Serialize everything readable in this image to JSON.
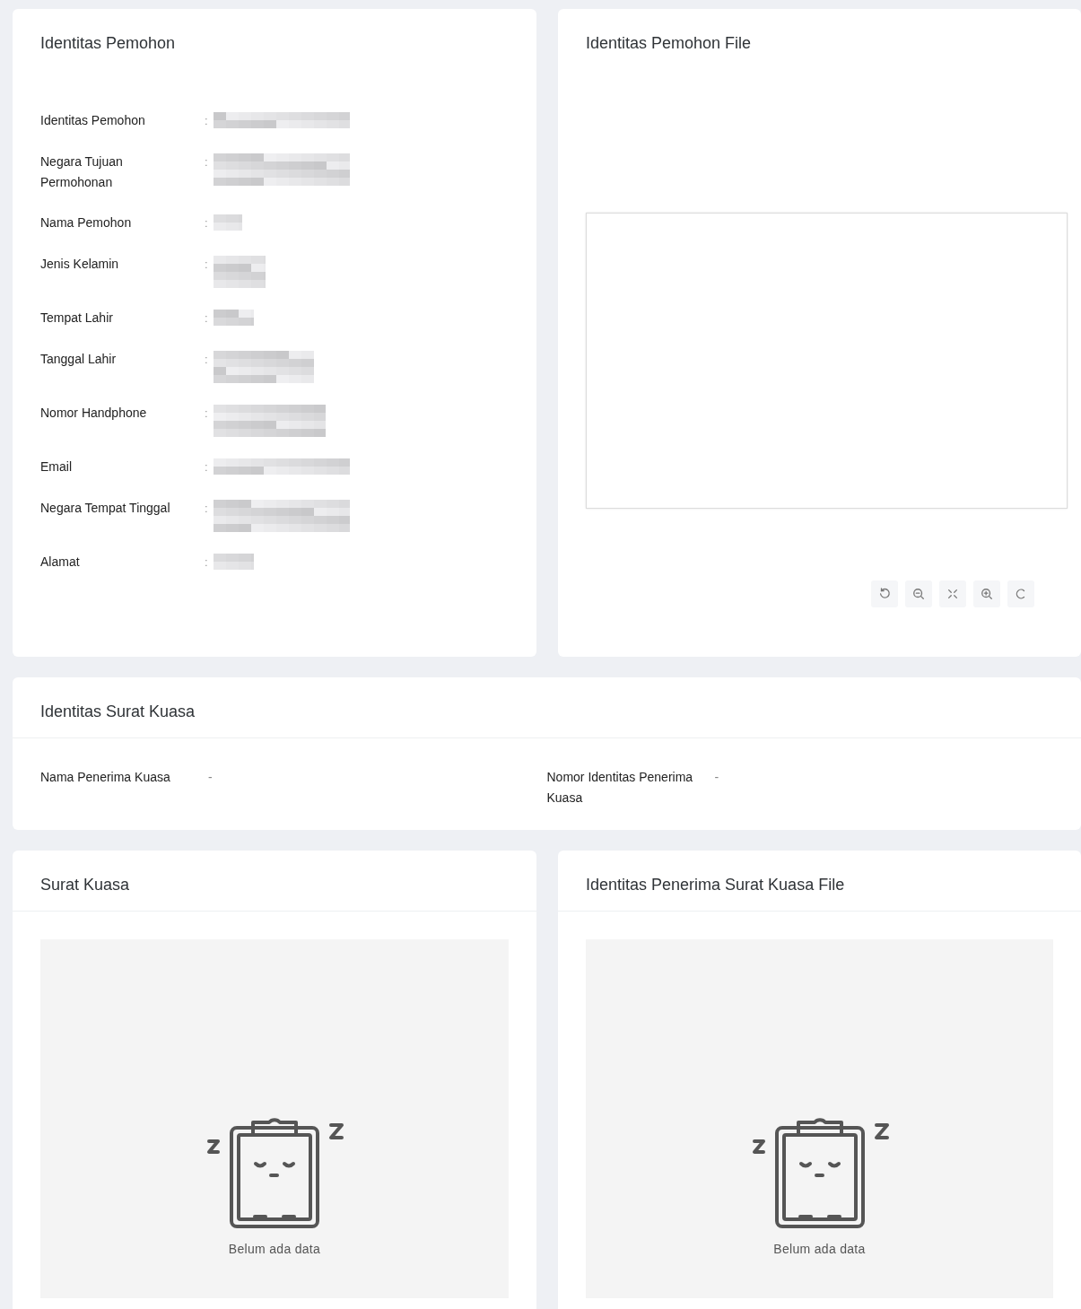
{
  "applicant": {
    "title": "Identitas Pemohon",
    "fields": [
      {
        "label": "Identitas Pemohon",
        "separator": ":",
        "redacted": true
      },
      {
        "label": "Negara Tujuan Permohonan",
        "separator": ":",
        "redacted": true
      },
      {
        "label": "Nama Pemohon",
        "separator": ":",
        "redacted": true
      },
      {
        "label": "Jenis Kelamin",
        "separator": ":",
        "redacted": true
      },
      {
        "label": "Tempat Lahir",
        "separator": ":",
        "redacted": true
      },
      {
        "label": "Tanggal Lahir",
        "separator": ":",
        "redacted": true
      },
      {
        "label": "Nomor Handphone",
        "separator": ":",
        "redacted": true
      },
      {
        "label": "Email",
        "separator": ":",
        "redacted": true
      },
      {
        "label": "Negara Tempat Tinggal",
        "separator": ":",
        "redacted": true
      },
      {
        "label": "Alamat",
        "separator": ":",
        "redacted": true
      }
    ]
  },
  "applicant_file": {
    "title": "Identitas Pemohon File",
    "tools": [
      {
        "kind": "rotate-left"
      },
      {
        "kind": "zoom-out"
      },
      {
        "kind": "fit"
      },
      {
        "kind": "zoom-in"
      },
      {
        "kind": "rotate-right"
      }
    ]
  },
  "power_of_attorney": {
    "title": "Identitas Surat Kuasa",
    "fields": [
      {
        "label": "Nama Penerima Kuasa",
        "value": "-"
      },
      {
        "label": "Nomor Identitas Penerima Kuasa",
        "value": "-"
      }
    ]
  },
  "files": [
    {
      "title": "Surat Kuasa",
      "empty_text": "Belum ada data"
    },
    {
      "title": "Identitas Penerima Surat Kuasa File",
      "empty_text": "Belum ada data"
    }
  ]
}
